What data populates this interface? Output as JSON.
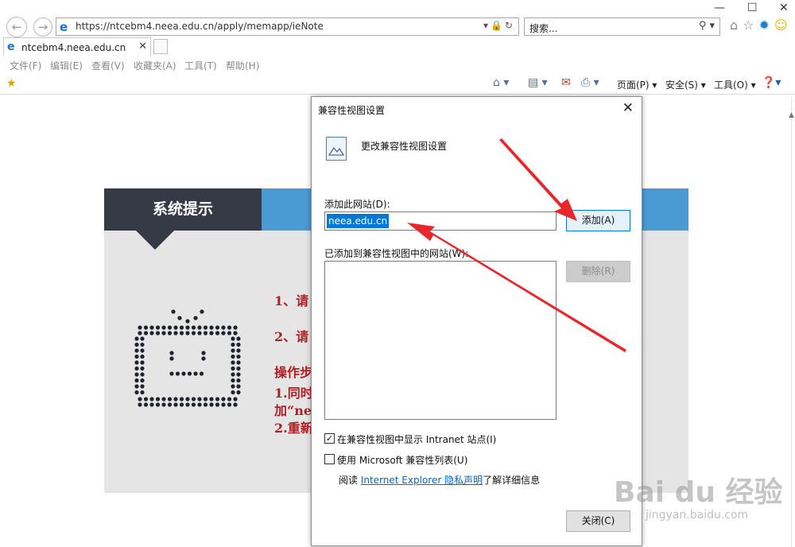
{
  "browser": {
    "url": "https://ntcebm4.neea.edu.cn/apply/memapp/ieNote",
    "search_placeholder": "搜索...",
    "tab_title": "ntcebm4.neea.edu.cn",
    "menu": [
      "文件(F)",
      "编辑(E)",
      "查看(V)",
      "收藏夹(A)",
      "工具(T)",
      "帮助(H)"
    ],
    "commands": {
      "page": "页面(P) ▾",
      "safety": "安全(S) ▾",
      "tools": "工具(O) ▾"
    }
  },
  "notice": {
    "title": "系统提示",
    "lines": [
      "1、请",
      "2、请",
      "操作步",
      "1.同时",
      "加“ne",
      "2.重新"
    ]
  },
  "dialog": {
    "title": "兼容性视图设置",
    "heading": "更改兼容性视图设置",
    "add_site_label": "添加此网站(D):",
    "site_value": "neea.edu.cn",
    "add_button": "添加(A)",
    "added_sites_label": "已添加到兼容性视图中的网站(W):",
    "remove_button": "删除(R)",
    "intranet_checkbox": {
      "label": "在兼容性视图中显示 Intranet 站点(I)",
      "checked": true
    },
    "mslist_checkbox": {
      "label": "使用 Microsoft 兼容性列表(U)",
      "checked": false
    },
    "privacy_prefix": "阅读 ",
    "privacy_link": "Internet Explorer 隐私声明",
    "privacy_suffix": "了解详细信息",
    "close_button": "关闭(C)"
  },
  "watermark": {
    "brand": "Bai du 经验",
    "sub": "jingyan.baidu.com"
  },
  "colors": {
    "annotation_red": "#e8262b",
    "notice_dark": "#363a46",
    "notice_blue": "#4a9ad4",
    "notice_text": "#b01e23",
    "selection": "#0078d7"
  }
}
